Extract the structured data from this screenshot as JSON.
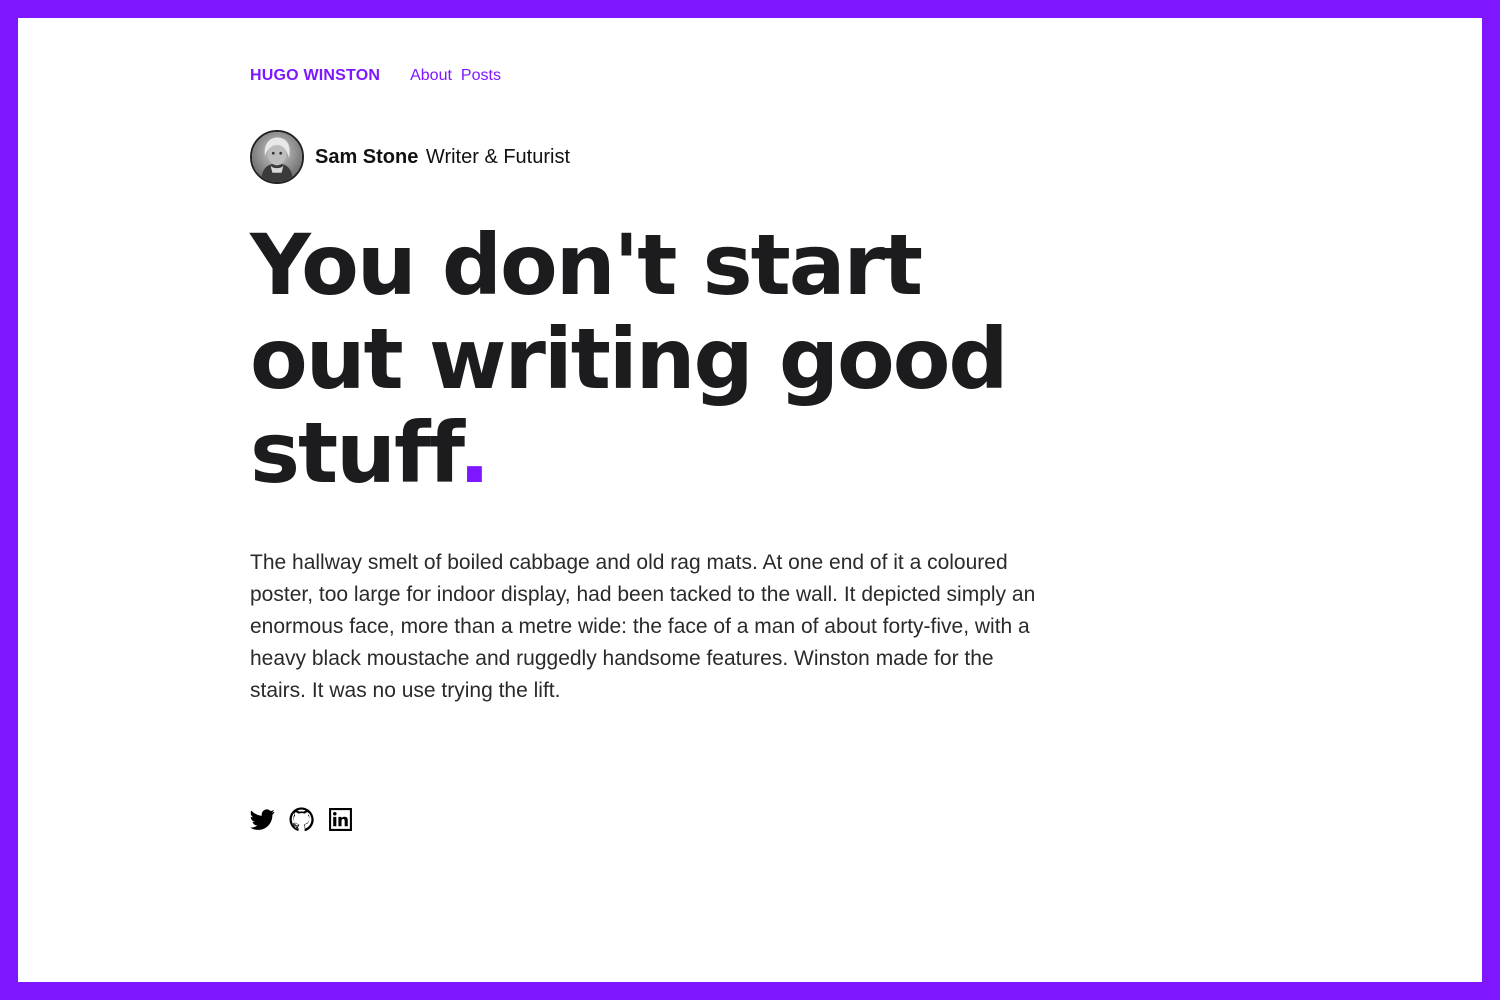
{
  "colors": {
    "accent": "#7e17ff",
    "text": "#1c1c1e",
    "background": "#ffffff"
  },
  "nav": {
    "brand": "HUGO WINSTON",
    "links": [
      {
        "label": "About"
      },
      {
        "label": "Posts"
      }
    ]
  },
  "author": {
    "name": "Sam Stone",
    "role": "Writer & Futurist",
    "avatar_icon": "avatar-photo"
  },
  "hero": {
    "headline": "You don't start out writing good stuff",
    "headline_dot": "."
  },
  "intro": {
    "text": "The hallway smelt of boiled cabbage and old rag mats. At one end of it a coloured poster, too large for indoor display, had been tacked to the wall. It depicted simply an enormous face, more than a metre wide: the face of a man of about forty-five, with a heavy black moustache and ruggedly handsome features. Winston made for the stairs. It was no use trying the lift."
  },
  "social": [
    {
      "icon": "twitter-icon"
    },
    {
      "icon": "github-icon"
    },
    {
      "icon": "linkedin-icon"
    }
  ]
}
